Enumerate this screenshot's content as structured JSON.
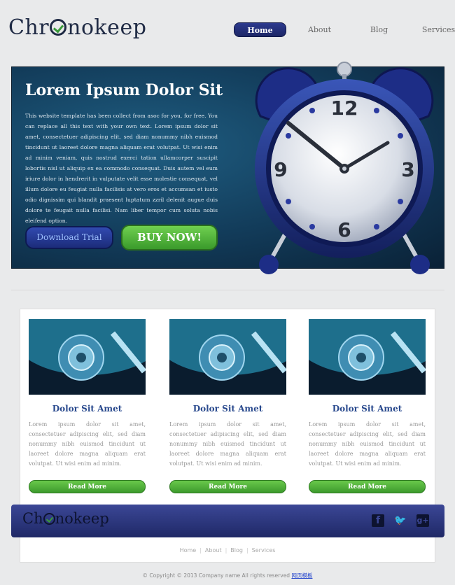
{
  "header": {
    "logo": {
      "part1": "Chr",
      "part2": "nokeep"
    },
    "nav": [
      {
        "label": "Home",
        "active": true
      },
      {
        "label": "About",
        "active": false
      },
      {
        "label": "Blog",
        "active": false
      },
      {
        "label": "Services",
        "active": false
      }
    ]
  },
  "hero": {
    "title": "Lorem Ipsum Dolor Sit",
    "body": "This website template has been collect from asoc for you, for free. You can replace all this text with your own text. Lorem ipsum dolor sit amet, consectetuer adipiscing elit, sed diam nonummy nibh euismod tincidunt ut laoreet dolore magna aliquam erat volutpat. Ut wisi enim ad minim veniam, quis nostrud exerci tation ullamcorper suscipit lobortis nisl ut aliquip ex ea commodo consequat. Duis autem vel eum iriure dolor in hendrerit in vulputate velit esse molestie consequat, vel illum dolore eu feugiat nulla facilisis at vero eros et accumsan et iusto odio dignissim qui blandit praesent luptatum zzril delenit augue duis dolore te feugait nulla facilisi. Nam liber tempor cum soluta nobis eleifend option.",
    "download_label": "Download Trial",
    "buy_label": "BUY NOW!",
    "clock": {
      "n12": "12",
      "n3": "3",
      "n6": "6",
      "n9": "9"
    }
  },
  "features": [
    {
      "title": "Dolor Sit Amet",
      "text": "Lorem ipsum dolor sit amet, consectetuer adipiscing elit, sed diam nonummy nibh euismod tincidunt ut laoreet dolore magna aliquam erat volutpat. Ut wisi enim ad minim.",
      "button": "Read More"
    },
    {
      "title": "Dolor Sit Amet",
      "text": "Lorem ipsum dolor sit amet, consectetuer adipiscing elit, sed diam nonummy nibh euismod tincidunt ut laoreet dolore magna aliquam erat volutpat. Ut wisi enim ad minim.",
      "button": "Read More"
    },
    {
      "title": "Dolor Sit Amet",
      "text": "Lorem ipsum dolor sit amet, consectetuer adipiscing elit, sed diam nonummy nibh euismod tincidunt ut laoreet dolore magna aliquam erat volutpat. Ut wisi enim ad minim.",
      "button": "Read More"
    }
  ],
  "footer": {
    "logo": {
      "part1": "Ch",
      "part2": "nokeep"
    },
    "social": {
      "facebook": "f",
      "twitter": "🐦",
      "gplus": "g+"
    },
    "links": [
      "Home",
      "About",
      "Blog",
      "Services"
    ],
    "copyright": "© Copyright © 2013 Company name All rights reserved ",
    "copyright_link": "网页模板"
  },
  "colors": {
    "brand_navy": "#1f2a44",
    "accent_blue": "#2c3a8e",
    "accent_green": "#3a9a2b"
  }
}
